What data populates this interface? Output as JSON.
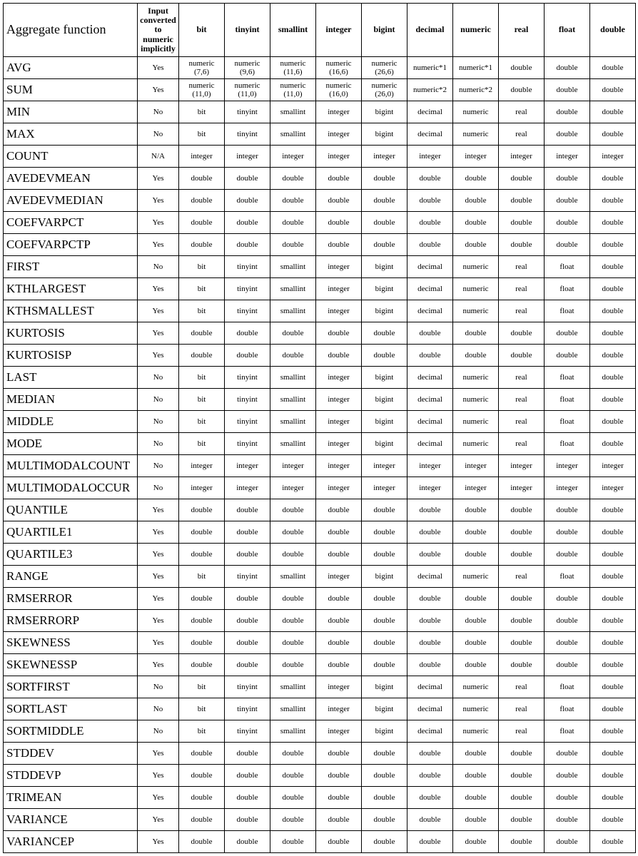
{
  "columns": [
    "Aggregate function",
    "Input converted to numeric implicitly",
    "bit",
    "tinyint",
    "smallint",
    "integer",
    "bigint",
    "decimal",
    "numeric",
    "real",
    "float",
    "double"
  ],
  "rows": [
    {
      "fn": "AVG",
      "conv": "Yes",
      "cells": [
        "numeric\n(7,6)",
        "numeric\n(9,6)",
        "numeric\n(11,6)",
        "numeric\n(16,6)",
        "numeric\n(26,6)",
        "numeric*1",
        "numeric*1",
        "double",
        "double",
        "double"
      ]
    },
    {
      "fn": "SUM",
      "conv": "Yes",
      "cells": [
        "numeric\n(11,0)",
        "numeric\n(11,0)",
        "numeric\n(11,0)",
        "numeric\n(16,0)",
        "numeric\n(26,0)",
        "numeric*2",
        "numeric*2",
        "double",
        "double",
        "double"
      ]
    },
    {
      "fn": "MIN",
      "conv": "No",
      "cells": [
        "bit",
        "tinyint",
        "smallint",
        "integer",
        "bigint",
        "decimal",
        "numeric",
        "real",
        "double",
        "double"
      ]
    },
    {
      "fn": "MAX",
      "conv": "No",
      "cells": [
        "bit",
        "tinyint",
        "smallint",
        "integer",
        "bigint",
        "decimal",
        "numeric",
        "real",
        "double",
        "double"
      ]
    },
    {
      "fn": "COUNT",
      "conv": "N/A",
      "cells": [
        "integer",
        "integer",
        "integer",
        "integer",
        "integer",
        "integer",
        "integer",
        "integer",
        "integer",
        "integer"
      ]
    },
    {
      "fn": "AVEDEVMEAN",
      "conv": "Yes",
      "cells": [
        "double",
        "double",
        "double",
        "double",
        "double",
        "double",
        "double",
        "double",
        "double",
        "double"
      ]
    },
    {
      "fn": "AVEDEVMEDIAN",
      "conv": "Yes",
      "cells": [
        "double",
        "double",
        "double",
        "double",
        "double",
        "double",
        "double",
        "double",
        "double",
        "double"
      ]
    },
    {
      "fn": "COEFVARPCT",
      "conv": "Yes",
      "cells": [
        "double",
        "double",
        "double",
        "double",
        "double",
        "double",
        "double",
        "double",
        "double",
        "double"
      ]
    },
    {
      "fn": "COEFVARPCTP",
      "conv": "Yes",
      "cells": [
        "double",
        "double",
        "double",
        "double",
        "double",
        "double",
        "double",
        "double",
        "double",
        "double"
      ]
    },
    {
      "fn": "FIRST",
      "conv": "No",
      "cells": [
        "bit",
        "tinyint",
        "smallint",
        "integer",
        "bigint",
        "decimal",
        "numeric",
        "real",
        "float",
        "double"
      ]
    },
    {
      "fn": "KTHLARGEST",
      "conv": "Yes",
      "cells": [
        "bit",
        "tinyint",
        "smallint",
        "integer",
        "bigint",
        "decimal",
        "numeric",
        "real",
        "float",
        "double"
      ]
    },
    {
      "fn": "KTHSMALLEST",
      "conv": "Yes",
      "cells": [
        "bit",
        "tinyint",
        "smallint",
        "integer",
        "bigint",
        "decimal",
        "numeric",
        "real",
        "float",
        "double"
      ]
    },
    {
      "fn": "KURTOSIS",
      "conv": "Yes",
      "cells": [
        "double",
        "double",
        "double",
        "double",
        "double",
        "double",
        "double",
        "double",
        "double",
        "double"
      ]
    },
    {
      "fn": "KURTOSISP",
      "conv": "Yes",
      "cells": [
        "double",
        "double",
        "double",
        "double",
        "double",
        "double",
        "double",
        "double",
        "double",
        "double"
      ]
    },
    {
      "fn": "LAST",
      "conv": "No",
      "cells": [
        "bit",
        "tinyint",
        "smallint",
        "integer",
        "bigint",
        "decimal",
        "numeric",
        "real",
        "float",
        "double"
      ]
    },
    {
      "fn": "MEDIAN",
      "conv": "No",
      "cells": [
        "bit",
        "tinyint",
        "smallint",
        "integer",
        "bigint",
        "decimal",
        "numeric",
        "real",
        "float",
        "double"
      ]
    },
    {
      "fn": "MIDDLE",
      "conv": "No",
      "cells": [
        "bit",
        "tinyint",
        "smallint",
        "integer",
        "bigint",
        "decimal",
        "numeric",
        "real",
        "float",
        "double"
      ]
    },
    {
      "fn": "MODE",
      "conv": "No",
      "cells": [
        "bit",
        "tinyint",
        "smallint",
        "integer",
        "bigint",
        "decimal",
        "numeric",
        "real",
        "float",
        "double"
      ]
    },
    {
      "fn": "MULTIMODALCOUNT",
      "conv": "No",
      "cells": [
        "integer",
        "integer",
        "integer",
        "integer",
        "integer",
        "integer",
        "integer",
        "integer",
        "integer",
        "integer"
      ]
    },
    {
      "fn": "MULTIMODALOCCUR",
      "conv": "No",
      "cells": [
        "integer",
        "integer",
        "integer",
        "integer",
        "integer",
        "integer",
        "integer",
        "integer",
        "integer",
        "integer"
      ]
    },
    {
      "fn": "QUANTILE",
      "conv": "Yes",
      "cells": [
        "double",
        "double",
        "double",
        "double",
        "double",
        "double",
        "double",
        "double",
        "double",
        "double"
      ]
    },
    {
      "fn": "QUARTILE1",
      "conv": "Yes",
      "cells": [
        "double",
        "double",
        "double",
        "double",
        "double",
        "double",
        "double",
        "double",
        "double",
        "double"
      ]
    },
    {
      "fn": "QUARTILE3",
      "conv": "Yes",
      "cells": [
        "double",
        "double",
        "double",
        "double",
        "double",
        "double",
        "double",
        "double",
        "double",
        "double"
      ]
    },
    {
      "fn": "RANGE",
      "conv": "Yes",
      "cells": [
        "bit",
        "tinyint",
        "smallint",
        "integer",
        "bigint",
        "decimal",
        "numeric",
        "real",
        "float",
        "double"
      ]
    },
    {
      "fn": "RMSERROR",
      "conv": "Yes",
      "cells": [
        "double",
        "double",
        "double",
        "double",
        "double",
        "double",
        "double",
        "double",
        "double",
        "double"
      ]
    },
    {
      "fn": "RMSERRORP",
      "conv": "Yes",
      "cells": [
        "double",
        "double",
        "double",
        "double",
        "double",
        "double",
        "double",
        "double",
        "double",
        "double"
      ]
    },
    {
      "fn": "SKEWNESS",
      "conv": "Yes",
      "cells": [
        "double",
        "double",
        "double",
        "double",
        "double",
        "double",
        "double",
        "double",
        "double",
        "double"
      ]
    },
    {
      "fn": "SKEWNESSP",
      "conv": "Yes",
      "cells": [
        "double",
        "double",
        "double",
        "double",
        "double",
        "double",
        "double",
        "double",
        "double",
        "double"
      ]
    },
    {
      "fn": "SORTFIRST",
      "conv": "No",
      "cells": [
        "bit",
        "tinyint",
        "smallint",
        "integer",
        "bigint",
        "decimal",
        "numeric",
        "real",
        "float",
        "double"
      ]
    },
    {
      "fn": "SORTLAST",
      "conv": "No",
      "cells": [
        "bit",
        "tinyint",
        "smallint",
        "integer",
        "bigint",
        "decimal",
        "numeric",
        "real",
        "float",
        "double"
      ]
    },
    {
      "fn": "SORTMIDDLE",
      "conv": "No",
      "cells": [
        "bit",
        "tinyint",
        "smallint",
        "integer",
        "bigint",
        "decimal",
        "numeric",
        "real",
        "float",
        "double"
      ]
    },
    {
      "fn": "STDDEV",
      "conv": "Yes",
      "cells": [
        "double",
        "double",
        "double",
        "double",
        "double",
        "double",
        "double",
        "double",
        "double",
        "double"
      ]
    },
    {
      "fn": "STDDEVP",
      "conv": "Yes",
      "cells": [
        "double",
        "double",
        "double",
        "double",
        "double",
        "double",
        "double",
        "double",
        "double",
        "double"
      ]
    },
    {
      "fn": "TRIMEAN",
      "conv": "Yes",
      "cells": [
        "double",
        "double",
        "double",
        "double",
        "double",
        "double",
        "double",
        "double",
        "double",
        "double"
      ]
    },
    {
      "fn": "VARIANCE",
      "conv": "Yes",
      "cells": [
        "double",
        "double",
        "double",
        "double",
        "double",
        "double",
        "double",
        "double",
        "double",
        "double"
      ]
    },
    {
      "fn": "VARIANCEP",
      "conv": "Yes",
      "cells": [
        "double",
        "double",
        "double",
        "double",
        "double",
        "double",
        "double",
        "double",
        "double",
        "double"
      ]
    }
  ]
}
